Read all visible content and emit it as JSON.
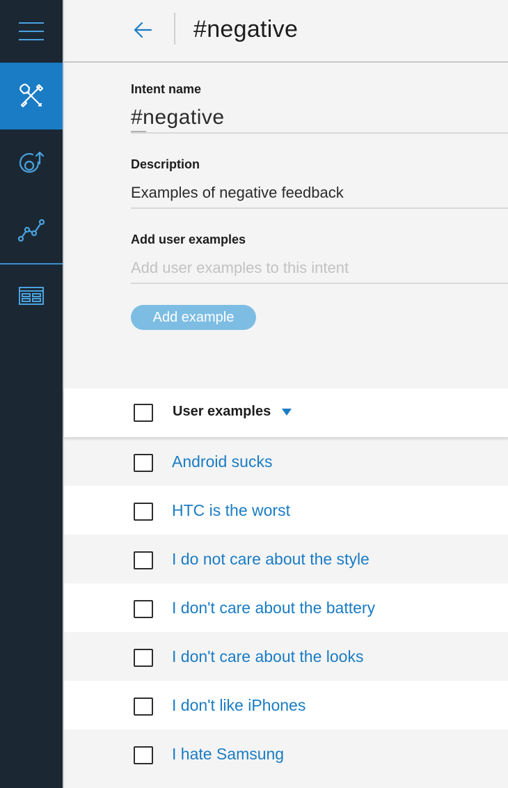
{
  "sidebar": {
    "items": [
      {
        "name": "menu",
        "icon": "hamburger-menu-icon"
      },
      {
        "name": "build",
        "icon": "tools-icon",
        "active": true
      },
      {
        "name": "deploy",
        "icon": "deploy-icon"
      },
      {
        "name": "improve",
        "icon": "analytics-icon"
      },
      {
        "name": "catalog",
        "icon": "catalog-icon"
      }
    ],
    "active_color": "#1a7cc4",
    "background": "#1b2834",
    "icon_color": "#4aa3e0"
  },
  "header": {
    "back_icon": "arrow-left-icon",
    "title": "#negative"
  },
  "form": {
    "intent_name_label": "Intent name",
    "intent_name_value": "#negative",
    "description_label": "Description",
    "description_value": "Examples of negative feedback",
    "user_examples_label": "Add user examples",
    "user_examples_placeholder": "Add user examples to this intent",
    "add_button_label": "Add example"
  },
  "table": {
    "header_label": "User examples",
    "sort_icon": "caret-down-icon",
    "rows": [
      "Android sucks",
      "HTC is the worst",
      "I do not care about the style",
      "I don't care about the battery",
      "I don't care about the looks",
      "I don't like iPhones",
      "I hate Samsung"
    ]
  }
}
